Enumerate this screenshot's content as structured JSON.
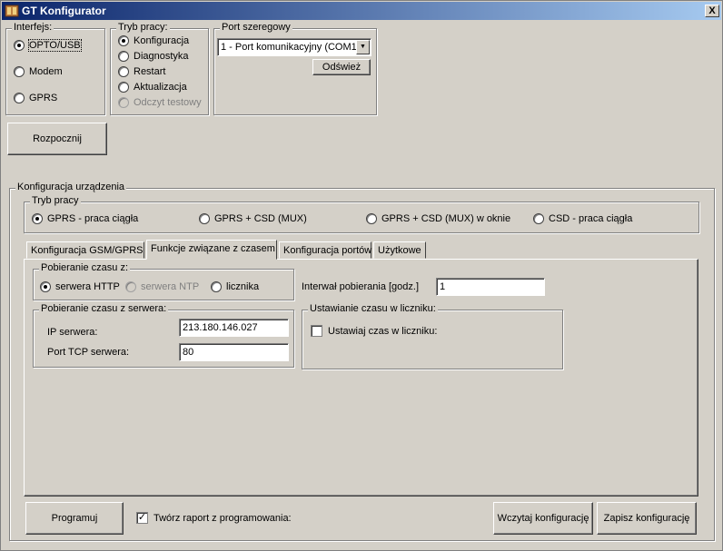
{
  "window": {
    "title": "GT Konfigurator",
    "close_label": "X",
    "app_icon": "gt-app-icon"
  },
  "interface": {
    "title": "Interfejs:",
    "options": [
      {
        "label": "OPTO/USB",
        "checked": true
      },
      {
        "label": "Modem",
        "checked": false
      },
      {
        "label": "GPRS",
        "checked": false
      }
    ]
  },
  "work_mode": {
    "title": "Tryb pracy:",
    "options": [
      {
        "label": "Konfiguracja",
        "checked": true,
        "disabled": false
      },
      {
        "label": "Diagnostyka",
        "checked": false,
        "disabled": false
      },
      {
        "label": "Restart",
        "checked": false,
        "disabled": false
      },
      {
        "label": "Aktualizacja",
        "checked": false,
        "disabled": false
      },
      {
        "label": "Odczyt testowy",
        "checked": false,
        "disabled": true
      }
    ]
  },
  "serial_port": {
    "title": "Port szeregowy",
    "selected": "1 - Port komunikacyjny (COM1)",
    "refresh_label": "Odśwież"
  },
  "start_button": "Rozpocznij",
  "device_config": {
    "title": "Konfiguracja urządzenia",
    "mode_group": {
      "title": "Tryb pracy",
      "options": [
        {
          "label": "GPRS - praca ciągła",
          "checked": true
        },
        {
          "label": "GPRS + CSD (MUX)",
          "checked": false
        },
        {
          "label": "GPRS + CSD (MUX) w oknie",
          "checked": false
        },
        {
          "label": "CSD - praca ciągła",
          "checked": false
        }
      ]
    },
    "tabs": [
      {
        "label": "Konfiguracja GSM/GPRS",
        "active": false
      },
      {
        "label": "Funkcje związane z czasem",
        "active": true
      },
      {
        "label": "Konfiguracja portów",
        "active": false
      },
      {
        "label": "Użytkowe",
        "active": false
      }
    ],
    "time_source": {
      "title": "Pobieranie czasu z:",
      "options": [
        {
          "label": "serwera HTTP",
          "checked": true,
          "disabled": false
        },
        {
          "label": "serwera NTP",
          "checked": false,
          "disabled": true
        },
        {
          "label": "licznika",
          "checked": false,
          "disabled": false
        }
      ]
    },
    "interval": {
      "label": "Interwał pobierania [godz.]",
      "value": "1"
    },
    "server_time": {
      "title": "Pobieranie czasu z serwera:",
      "ip_label": "IP serwera:",
      "ip_value": "213.180.146.027",
      "port_label": "Port TCP serwera:",
      "port_value": "80"
    },
    "meter_time": {
      "title": "Ustawianie czasu w liczniku:",
      "checkbox_label": "Ustawiaj czas w liczniku:",
      "checked": false
    }
  },
  "footer": {
    "program_button": "Programuj",
    "report_label": "Twórz raport z programowania:",
    "report_checked": true,
    "load_button": "Wczytaj konfigurację",
    "save_button": "Zapisz konfigurację"
  }
}
